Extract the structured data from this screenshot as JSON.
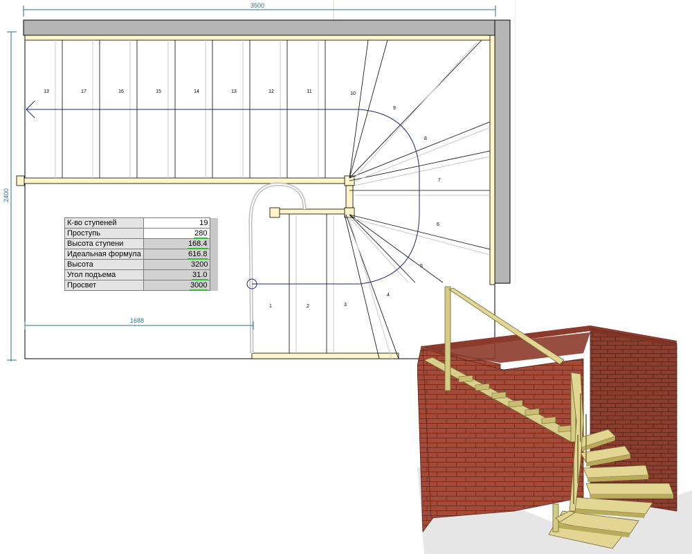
{
  "plan": {
    "dimension_width": "3500",
    "dimension_height": "2400",
    "dimension_landing": "1688",
    "step_numbers_upper": [
      "13",
      "17",
      "16",
      "15",
      "14",
      "13",
      "12",
      "11",
      "10"
    ],
    "step_numbers_winder": [
      "9",
      "8",
      "7",
      "6",
      "5",
      "4"
    ],
    "step_numbers_lower": [
      "1",
      "2",
      "3"
    ]
  },
  "stats_table": {
    "rows": [
      {
        "label": "К-во ступеней",
        "value": "19",
        "shade": "white",
        "underline": false
      },
      {
        "label": "Проступь",
        "value": "280",
        "shade": "white",
        "underline": true
      },
      {
        "label": "Высота ступени",
        "value": "168.4",
        "shade": "grey",
        "underline": true
      },
      {
        "label": "Идеальная формула",
        "value": "616.8",
        "shade": "grey",
        "underline": true
      },
      {
        "label": "Высота",
        "value": "3200",
        "shade": "grey",
        "underline": false
      },
      {
        "label": "Угол подъема",
        "value": "31.0",
        "shade": "grey",
        "underline": true
      },
      {
        "label": "Просвет",
        "value": "3000",
        "shade": "grey",
        "underline": true
      }
    ]
  },
  "colors": {
    "dimension": "#2a6f86",
    "wall": "#b4b4b4",
    "beam": "#fff5c8",
    "underline": "#27c227",
    "brick": "#a54a37"
  }
}
